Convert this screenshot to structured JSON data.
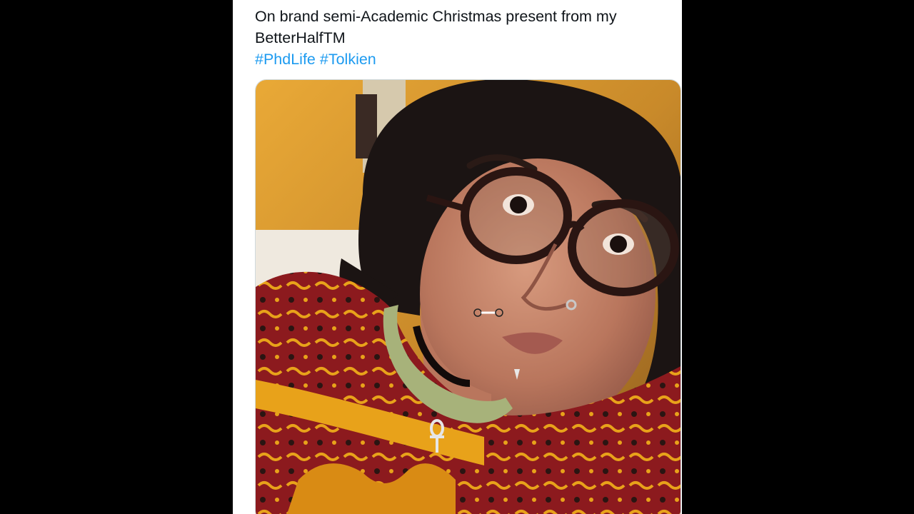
{
  "tweet": {
    "text_line1": "On brand semi-Academic Christmas present from my",
    "text_line2": "BetterHalfTM",
    "hashtags": [
      "#PhdLife",
      "#Tolkien"
    ]
  },
  "colors": {
    "letterbox": "#000000",
    "card_background": "#ffffff",
    "text": "#0f1419",
    "hashtag": "#1d9bf0",
    "sweater_red": "#8c1a1e",
    "sweater_yellow": "#e8a21a",
    "collar_green": "#a7b27a"
  },
  "icons": [
    "ankh-pendant-icon"
  ]
}
